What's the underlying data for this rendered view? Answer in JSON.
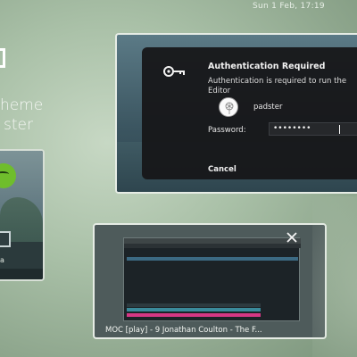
{
  "topbar": {
    "clock": "Sun  1 Feb, 17:19"
  },
  "left_window": {
    "text_line1": "heme",
    "text_line2": "ster",
    "thumb_caption": "a"
  },
  "auth_dialog": {
    "title": "Authentication Required",
    "description": "Authentication is required to run the",
    "description_line2": "Editor",
    "username": "padster",
    "password_label": "Password:",
    "password_value": "••••••••",
    "cancel_label": "Cancel"
  },
  "terminal_window": {
    "caption": "MOC [play] - 9 Jonathan Coulton - The F..."
  },
  "icons": {
    "key": "key-icon",
    "close": "close-icon",
    "avatar": "dandelion-avatar"
  }
}
